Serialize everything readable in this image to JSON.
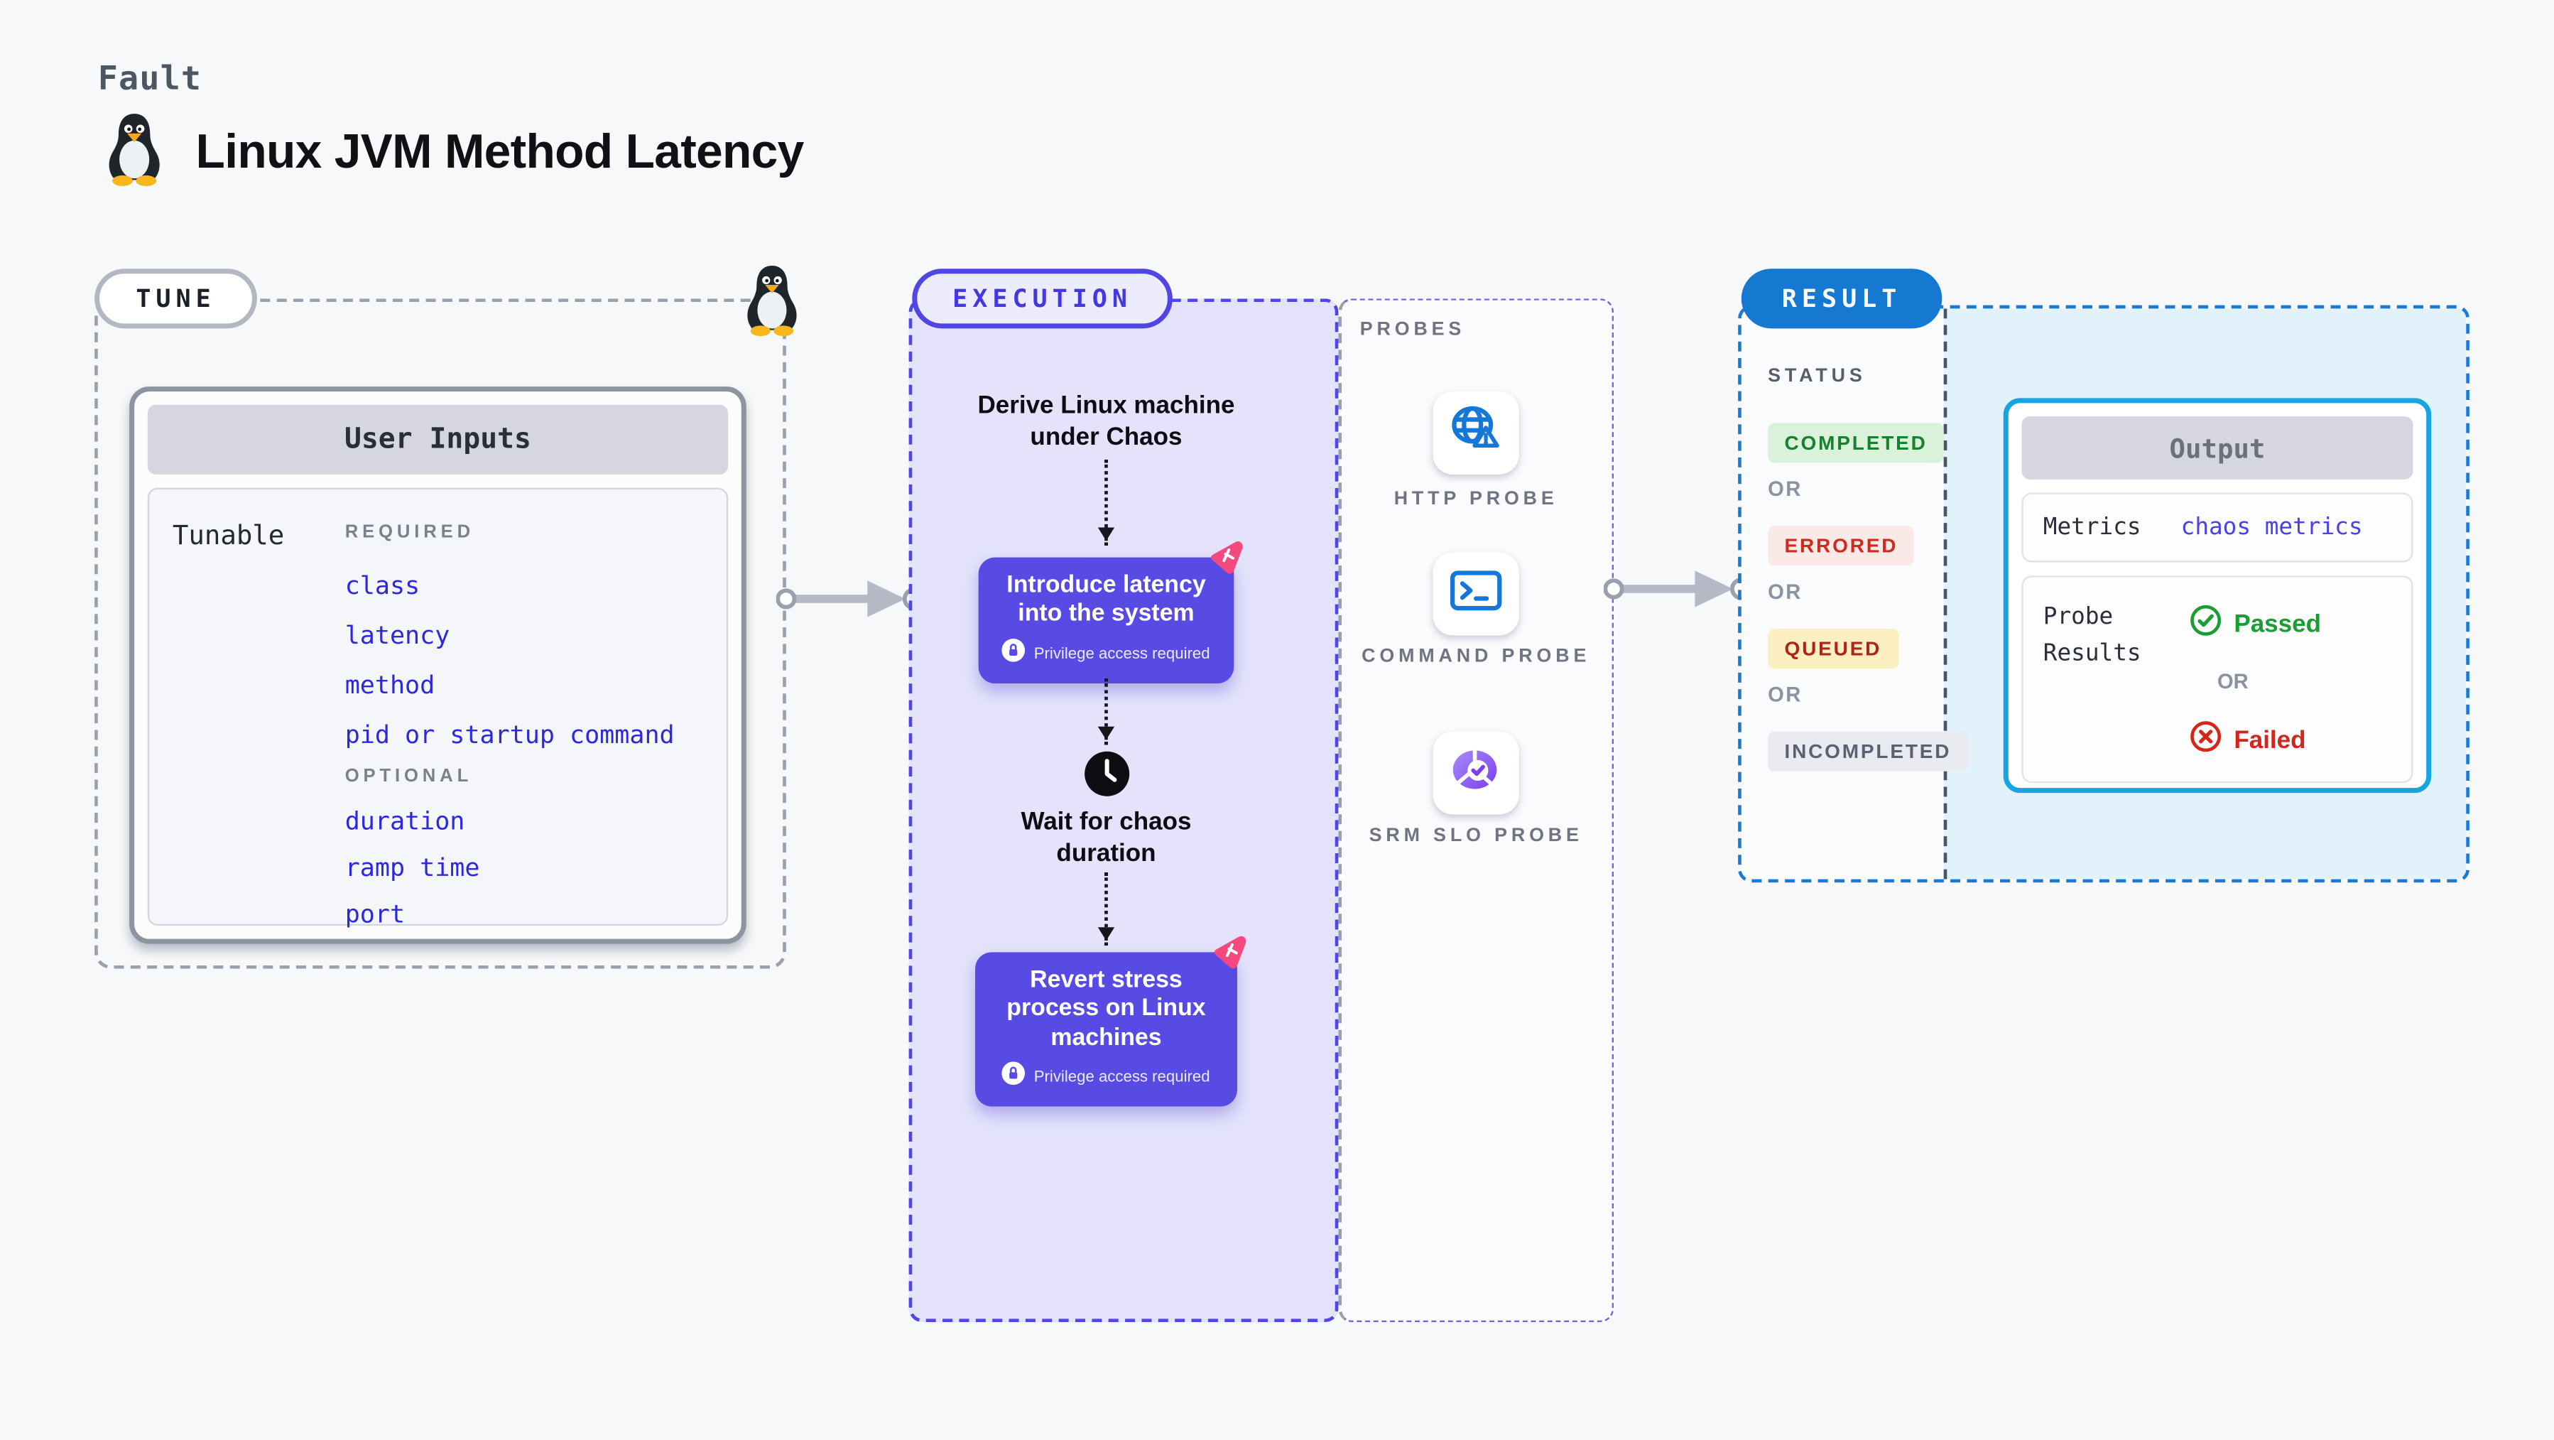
{
  "page": {
    "kicker": "Fault",
    "title": "Linux JVM Method Latency"
  },
  "tune": {
    "label": "TUNE",
    "card_title": "User Inputs",
    "row_label": "Tunable",
    "required_label": "REQUIRED",
    "required_params": [
      "class",
      "latency",
      "method",
      "pid or startup command"
    ],
    "optional_label": "OPTIONAL",
    "optional_params": [
      "duration",
      "ramp time",
      "port"
    ]
  },
  "execution": {
    "label": "EXECUTION",
    "derive_step": "Derive Linux machine under Chaos",
    "introduce_action": {
      "title": "Introduce latency into the system",
      "badge": "Privilege access required"
    },
    "wait_step": "Wait for chaos duration",
    "revert_action": {
      "title": "Revert stress process on Linux machines",
      "badge": "Privilege access required"
    }
  },
  "probes": {
    "label": "PROBES",
    "items": [
      {
        "name": "HTTP PROBE",
        "icon": "globe-alert-icon"
      },
      {
        "name": "COMMAND PROBE",
        "icon": "terminal-icon"
      },
      {
        "name": "SRM SLO PROBE",
        "icon": "slo-gauge-icon"
      }
    ]
  },
  "result": {
    "label": "RESULT",
    "status_label": "STATUS",
    "or_label": "OR",
    "statuses": [
      "COMPLETED",
      "ERRORED",
      "QUEUED",
      "INCOMPLETED"
    ],
    "output": {
      "title": "Output",
      "metrics_label": "Metrics",
      "metrics_value": "chaos metrics",
      "probe_results_label": "Probe Results",
      "passed_label": "Passed",
      "failed_label": "Failed"
    }
  },
  "colors": {
    "page_bg": "#f7f8fa",
    "accent_indigo": "#4f46e5",
    "action_purple": "#584be4",
    "execution_lavender": "#e4e3fb",
    "link_blue": "#2b28dd",
    "probe_icon_blue": "#1577d6",
    "slo_purple": "#7c3ef0",
    "result_blue": "#1579d2",
    "output_border_cyan": "#16a4e2",
    "result_panel_cyan": "#e2f2fb",
    "completed_green": "#1a7f2e",
    "errored_red": "#cf2a20",
    "queued_bg_yellow": "#fcf0c3",
    "passed_green": "#1a9e33",
    "failed_red": "#d3271c",
    "litmus_pink": "#f5487f"
  }
}
